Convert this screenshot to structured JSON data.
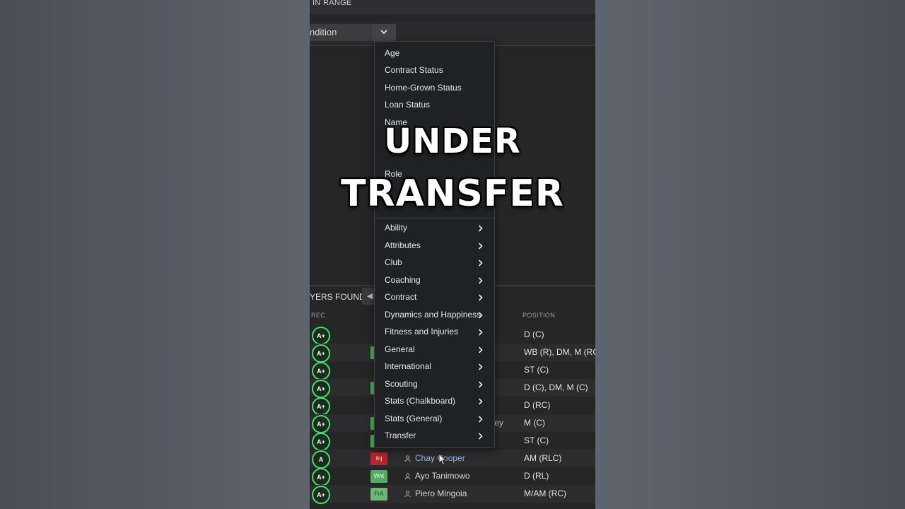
{
  "header": {
    "title": "IN RANGE"
  },
  "filter": {
    "condition_label": "ndition"
  },
  "results": {
    "found_label": "YERS FOUND",
    "columns": {
      "rec": "REC",
      "position": "POSITION"
    },
    "rows": [
      {
        "rec": "A+",
        "tag": "",
        "name": "",
        "extra": "",
        "position": "D (C)"
      },
      {
        "rec": "A+",
        "tag": "",
        "name": "",
        "extra": "",
        "position": "WB (R), DM, M (RC)"
      },
      {
        "rec": "A+",
        "tag": "",
        "name": "",
        "extra": "",
        "position": "ST (C)"
      },
      {
        "rec": "A+",
        "tag": "",
        "name": "",
        "extra": "",
        "position": "D (C), DM, M (C)"
      },
      {
        "rec": "A+",
        "tag": "",
        "name": "",
        "extra": "",
        "position": "D (RC)"
      },
      {
        "rec": "A+",
        "tag": "",
        "name": "",
        "extra": "tey",
        "position": "M (C)"
      },
      {
        "rec": "A+",
        "tag": "",
        "name": "",
        "extra": "",
        "position": "ST (C)"
      },
      {
        "rec": "A",
        "tag": "Inj",
        "name": "Chay Cooper",
        "extra": "",
        "position": "AM (RLC)"
      },
      {
        "rec": "A+",
        "tag": "Wnt",
        "name": "Ayo Tanimowo",
        "extra": "",
        "position": "D (RL)"
      },
      {
        "rec": "A+",
        "tag": "FrA",
        "name": "Piero Mingoia",
        "extra": "",
        "position": "M/AM (RC)"
      }
    ]
  },
  "menu": {
    "items": [
      {
        "label": "Age",
        "submenu": false
      },
      {
        "label": "Contract Status",
        "submenu": false
      },
      {
        "label": "Home-Grown Status",
        "submenu": false
      },
      {
        "label": "Loan Status",
        "submenu": false
      },
      {
        "label": "Name",
        "submenu": false
      },
      {
        "label": "Role",
        "submenu": false
      },
      {
        "label": "Ability",
        "submenu": true
      },
      {
        "label": "Attributes",
        "submenu": true
      },
      {
        "label": "Club",
        "submenu": true
      },
      {
        "label": "Coaching",
        "submenu": true
      },
      {
        "label": "Contract",
        "submenu": true
      },
      {
        "label": "Dynamics and Happiness",
        "submenu": true
      },
      {
        "label": "Fitness and Injuries",
        "submenu": true
      },
      {
        "label": "General",
        "submenu": true
      },
      {
        "label": "International",
        "submenu": true
      },
      {
        "label": "Scouting",
        "submenu": true
      },
      {
        "label": "Stats (Chalkboard)",
        "submenu": true
      },
      {
        "label": "Stats (General)",
        "submenu": true
      },
      {
        "label": "Transfer",
        "submenu": true
      }
    ]
  },
  "overlay": {
    "line1": "UNDER",
    "line2": "TRANSFER"
  },
  "icons": {
    "dropdown": "chevron-down-icon",
    "submenu": "chevron-right-icon",
    "person": "person-icon",
    "cursor": "mouse-cursor-icon"
  },
  "colors": {
    "rec_ring": "#3fe06a",
    "tag_injured": "#b3262b",
    "tag_green": "#5aa866",
    "link": "#8fb6ea"
  }
}
